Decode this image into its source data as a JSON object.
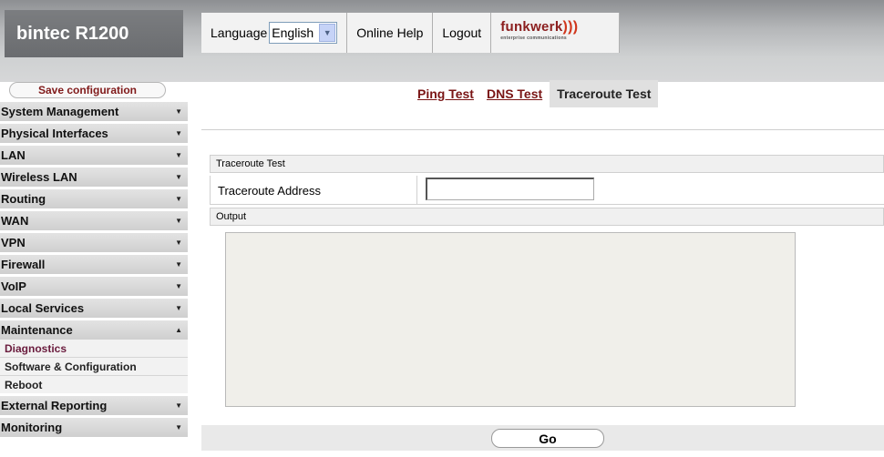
{
  "header": {
    "brand": "bintec R1200",
    "language_label": "Language",
    "language_value": "English",
    "online_help": "Online Help",
    "logout": "Logout",
    "logo_text": "funkwerk",
    "logo_subtext": "enterprise communications"
  },
  "sidebar": {
    "save_label": "Save configuration",
    "items": [
      {
        "label": "System Management"
      },
      {
        "label": "Physical Interfaces"
      },
      {
        "label": "LAN"
      },
      {
        "label": "Wireless LAN"
      },
      {
        "label": "Routing"
      },
      {
        "label": "WAN"
      },
      {
        "label": "VPN"
      },
      {
        "label": "Firewall"
      },
      {
        "label": "VoIP"
      },
      {
        "label": "Local Services"
      },
      {
        "label": "Maintenance"
      }
    ],
    "maintenance_sub": [
      {
        "label": "Diagnostics"
      },
      {
        "label": "Software & Configuration"
      },
      {
        "label": "Reboot"
      }
    ],
    "items_after": [
      {
        "label": "External Reporting"
      },
      {
        "label": "Monitoring"
      }
    ]
  },
  "tabs": {
    "ping": "Ping Test",
    "dns": "DNS Test",
    "traceroute": "Traceroute Test"
  },
  "form": {
    "section_title": "Traceroute Test",
    "address_label": "Traceroute Address",
    "address_value": "",
    "output_title": "Output",
    "go_label": "Go"
  },
  "colors": {
    "link": "#7a1515",
    "active_sub": "#6a1b3d"
  }
}
